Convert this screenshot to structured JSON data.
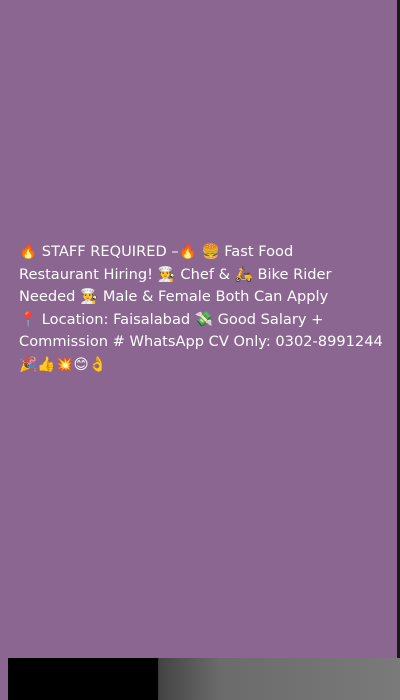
{
  "post": {
    "line1": "🔥 STAFF REQUIRED –🔥 🍔 Fast Food",
    "line2": "Restaurant Hiring! 👨‍🍳 Chef & 🛵 Bike Rider",
    "line3": "Needed 👨‍🍳 Male & Female Both Can Apply",
    "line4": "📍 Location: Faisalabad 💸 Good Salary +",
    "line5": "Commission # WhatsApp CV Only: 0302-8991244",
    "line6": "🎉👍💥😊👌"
  },
  "colors": {
    "background": "#8a6690",
    "text": "#ffffff"
  }
}
